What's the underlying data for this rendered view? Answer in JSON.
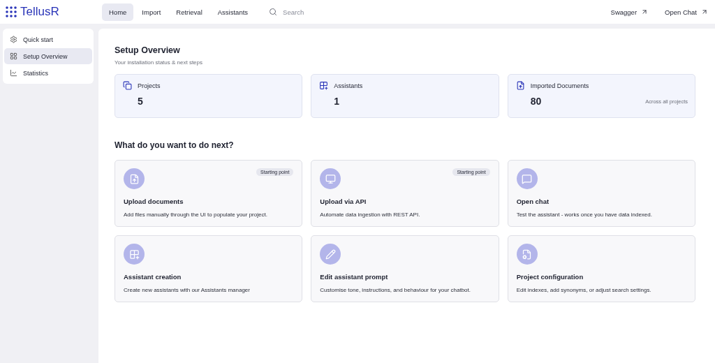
{
  "brand": "TellusR",
  "nav": [
    {
      "label": "Home",
      "selected": true
    },
    {
      "label": "Import",
      "selected": false
    },
    {
      "label": "Retrieval",
      "selected": false
    },
    {
      "label": "Assistants",
      "selected": false
    }
  ],
  "search": {
    "placeholder": "Search"
  },
  "links": [
    "Swagger",
    "Open Chat"
  ],
  "sidebar": {
    "items": [
      {
        "label": "Quick start",
        "selected": false
      },
      {
        "label": "Setup Overview",
        "selected": true
      },
      {
        "label": "Statistics",
        "selected": false
      }
    ]
  },
  "page": {
    "title": "Setup Overview",
    "subtitle": "Your installation status & next steps"
  },
  "stats": [
    {
      "label": "Projects",
      "value": "5"
    },
    {
      "label": "Assistants",
      "value": "1"
    },
    {
      "label": "Imported Documents",
      "value": "80",
      "note": "Across all projects"
    }
  ],
  "next": {
    "title": "What do you want to do next?",
    "actions": [
      {
        "title": "Upload documents",
        "description": "Add files manually through the UI to populate your project.",
        "badge": "Starting point"
      },
      {
        "title": "Upload via API",
        "description": "Automate data ingestion with REST API.",
        "badge": "Starting point"
      },
      {
        "title": "Open chat",
        "description": "Test the assistant - works once you have data indexed."
      },
      {
        "title": "Assistant creation",
        "description": "Create new assistants with our Assistants manager"
      },
      {
        "title": "Edit assistant prompt",
        "description": "Customise tone, instructions, and behaviour for your chatbot."
      },
      {
        "title": "Project configuration",
        "description": "Edit indexes, add synonyms, or adjust search settings."
      }
    ]
  }
}
